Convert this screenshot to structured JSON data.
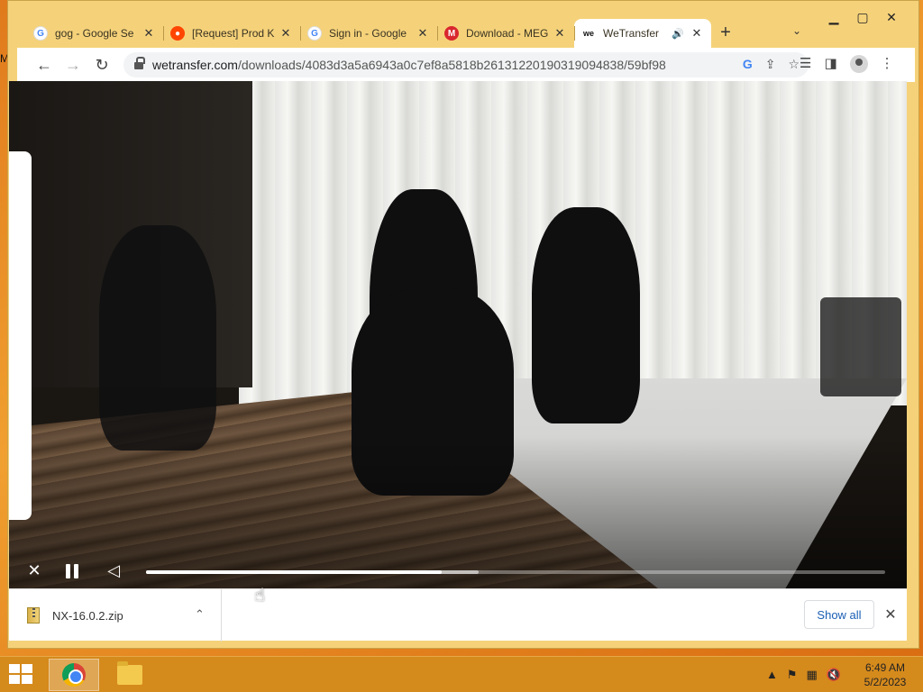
{
  "browser": {
    "tabs": [
      {
        "title": "gog - Google Se",
        "favicon": "google-icon",
        "active": false
      },
      {
        "title": "[Request] Prod K",
        "favicon": "reddit-icon",
        "active": false
      },
      {
        "title": "Sign in - Google",
        "favicon": "google-icon",
        "active": false
      },
      {
        "title": "Download - MEG",
        "favicon": "mega-icon",
        "active": false
      },
      {
        "title": "WeTransfer",
        "favicon": "wetransfer-icon",
        "active": true,
        "audio": true
      }
    ],
    "new_tab": "+",
    "url_domain": "wetransfer.com",
    "url_path": "/downloads/4083d3a5a6943a0c7ef8a5818b26131220190319094838/59bf98"
  },
  "player": {
    "progress": 0.4,
    "buffered": 0.45,
    "state": "playing"
  },
  "downloads": {
    "items": [
      {
        "name": "NX-16.0.2.zip"
      }
    ],
    "show_all_label": "Show all"
  },
  "taskbar": {
    "time": "6:49 AM",
    "date": "5/2/2023"
  }
}
